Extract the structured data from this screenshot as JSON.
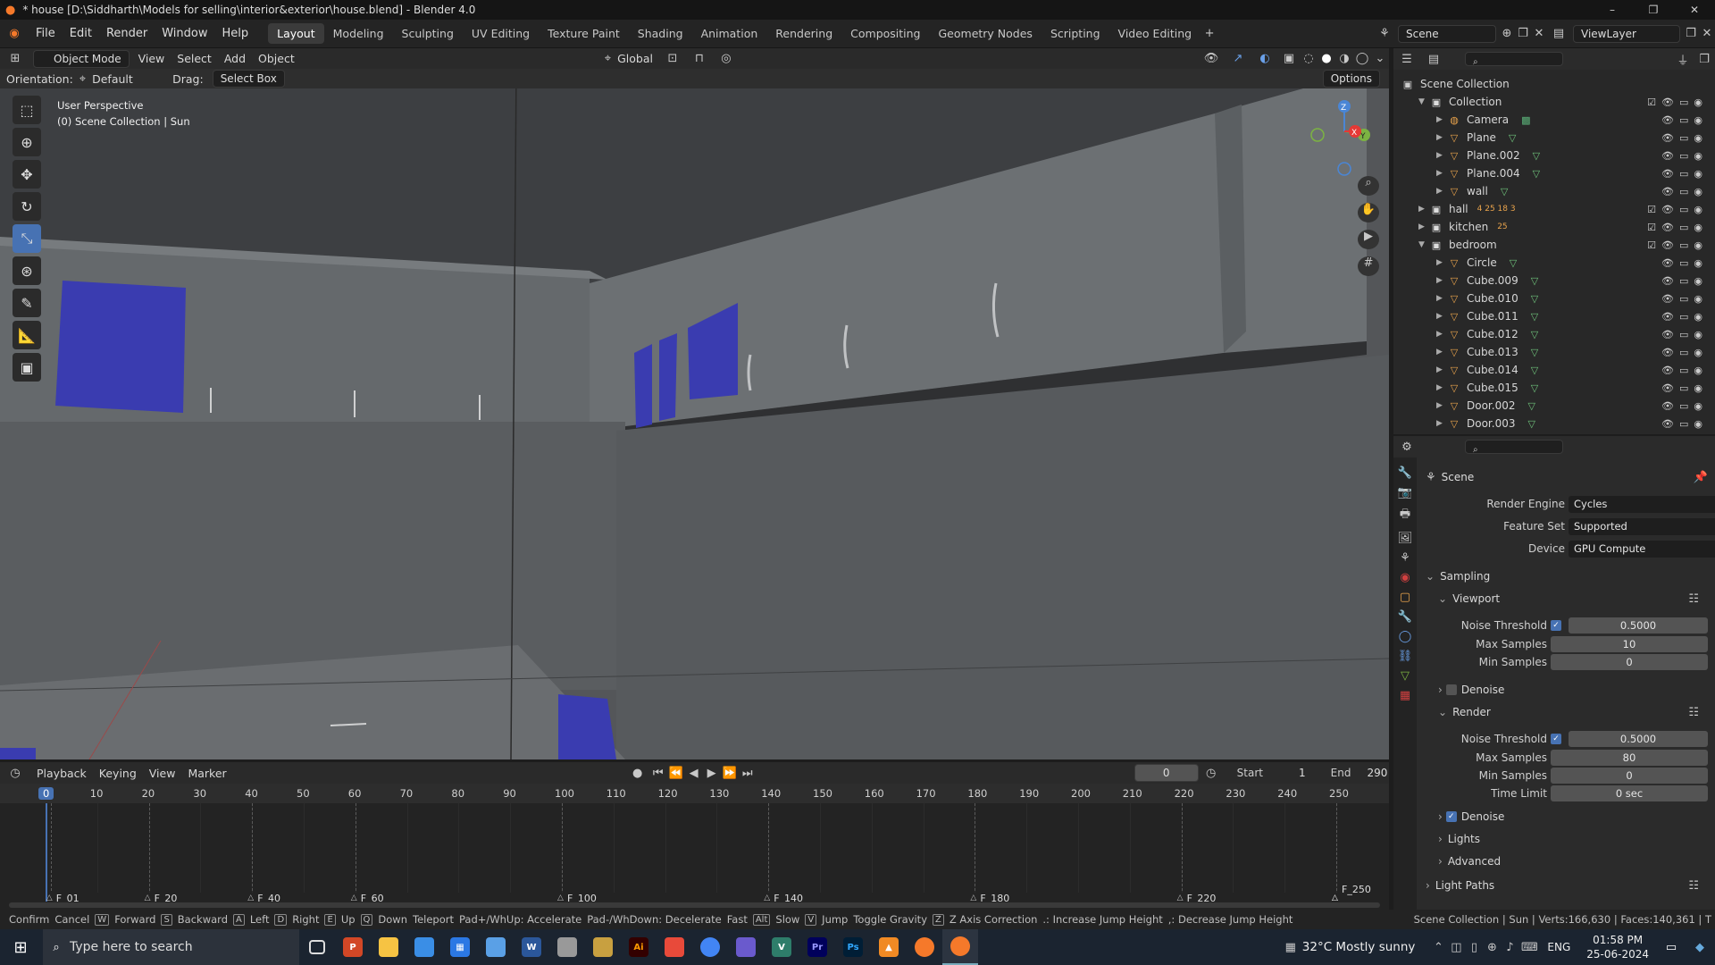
{
  "window": {
    "title": "* house [D:\\Siddharth\\Models for selling\\interior&exterior\\house.blend] - Blender 4.0"
  },
  "menu": [
    "File",
    "Edit",
    "Render",
    "Window",
    "Help"
  ],
  "workspaces": [
    "Layout",
    "Modeling",
    "Sculpting",
    "UV Editing",
    "Texture Paint",
    "Shading",
    "Animation",
    "Rendering",
    "Compositing",
    "Geometry Nodes",
    "Scripting",
    "Video Editing"
  ],
  "scene": {
    "name": "Scene",
    "view_layer": "ViewLayer"
  },
  "header": {
    "mode": "Object Mode",
    "view": "View",
    "select": "Select",
    "add": "Add",
    "object": "Object",
    "transform": "Global",
    "options": "Options"
  },
  "tool_settings": {
    "orientation_label": "Orientation:",
    "orientation": "Default",
    "drag_label": "Drag:",
    "drag": "Select Box"
  },
  "viewport": {
    "perspective": "User Perspective",
    "context": "(0) Scene Collection | Sun"
  },
  "timeline": {
    "playback": "Playback",
    "keying": "Keying",
    "view": "View",
    "marker": "Marker",
    "current_frame": "0",
    "start_label": "Start",
    "start": "1",
    "end_label": "End",
    "end": "290",
    "ticks": [
      "0",
      "10",
      "20",
      "30",
      "40",
      "50",
      "60",
      "70",
      "80",
      "90",
      "100",
      "110",
      "120",
      "130",
      "140",
      "150",
      "160",
      "170",
      "180",
      "190",
      "200",
      "210",
      "220",
      "230",
      "240",
      "250"
    ],
    "markers": [
      "F_01",
      "F_20",
      "F_40",
      "F_60",
      "F_100",
      "F_140",
      "F_180",
      "F_220",
      "F_250"
    ]
  },
  "outliner": {
    "root": "Scene Collection",
    "items": [
      {
        "name": "Collection",
        "level": 0,
        "type": "collection"
      },
      {
        "name": "Camera",
        "level": 1,
        "type": "camera"
      },
      {
        "name": "Plane",
        "level": 1,
        "type": "mesh"
      },
      {
        "name": "Plane.002",
        "level": 1,
        "type": "mesh"
      },
      {
        "name": "Plane.004",
        "level": 1,
        "type": "mesh"
      },
      {
        "name": "wall",
        "level": 1,
        "type": "mesh"
      },
      {
        "name": "hall",
        "level": 0,
        "type": "collection",
        "extra": "4  25  18  3"
      },
      {
        "name": "kitchen",
        "level": 0,
        "type": "collection",
        "extra": "25"
      },
      {
        "name": "bedroom",
        "level": 0,
        "type": "collection"
      },
      {
        "name": "Circle",
        "level": 1,
        "type": "mesh"
      },
      {
        "name": "Cube.009",
        "level": 1,
        "type": "mesh"
      },
      {
        "name": "Cube.010",
        "level": 1,
        "type": "mesh"
      },
      {
        "name": "Cube.011",
        "level": 1,
        "type": "mesh"
      },
      {
        "name": "Cube.012",
        "level": 1,
        "type": "mesh"
      },
      {
        "name": "Cube.013",
        "level": 1,
        "type": "mesh"
      },
      {
        "name": "Cube.014",
        "level": 1,
        "type": "mesh"
      },
      {
        "name": "Cube.015",
        "level": 1,
        "type": "mesh"
      },
      {
        "name": "Door.002",
        "level": 1,
        "type": "mesh"
      },
      {
        "name": "Door.003",
        "level": 1,
        "type": "mesh"
      }
    ]
  },
  "properties": {
    "context": "Scene",
    "render_engine_label": "Render Engine",
    "render_engine": "Cycles",
    "feature_set_label": "Feature Set",
    "feature_set": "Supported",
    "device_label": "Device",
    "device": "GPU Compute",
    "sampling": "Sampling",
    "viewport": "Viewport",
    "noise_threshold_label": "Noise Threshold",
    "viewport_noise": "0.5000",
    "max_samples_label": "Max Samples",
    "viewport_max": "10",
    "min_samples_label": "Min Samples",
    "viewport_min": "0",
    "denoise": "Denoise",
    "render": "Render",
    "render_noise": "0.5000",
    "render_max": "80",
    "render_min": "0",
    "time_limit_label": "Time Limit",
    "time_limit": "0 sec",
    "lights": "Lights",
    "advanced": "Advanced",
    "light_paths": "Light Paths"
  },
  "status": {
    "items": [
      "Confirm",
      "Cancel",
      "W",
      "Forward",
      "S",
      "Backward",
      "A",
      "Left",
      "D",
      "Right",
      "E",
      "Up",
      "Q",
      "Down",
      "Teleport",
      "Pad+/WhUp: Accelerate",
      "Pad-/WhDown: Decelerate",
      "Fast",
      "Alt",
      "Slow",
      "V",
      "Jump",
      "Toggle Gravity",
      "Z",
      "Z Axis Correction",
      ".: Increase Jump Height",
      ",: Decrease Jump Height"
    ],
    "stats": "Scene Collection | Sun | Verts:166,630 | Faces:140,361 | T"
  },
  "taskbar": {
    "search": "Type here to search",
    "weather": "32°C  Mostly sunny",
    "lang": "ENG",
    "time": "01:58 PM",
    "date": "25-06-2024"
  },
  "colors": {
    "accent": "#4772b3",
    "viewport_bg": "#4d4e50",
    "cabinet": "#6e7275",
    "panel": "#3a3cb0"
  }
}
